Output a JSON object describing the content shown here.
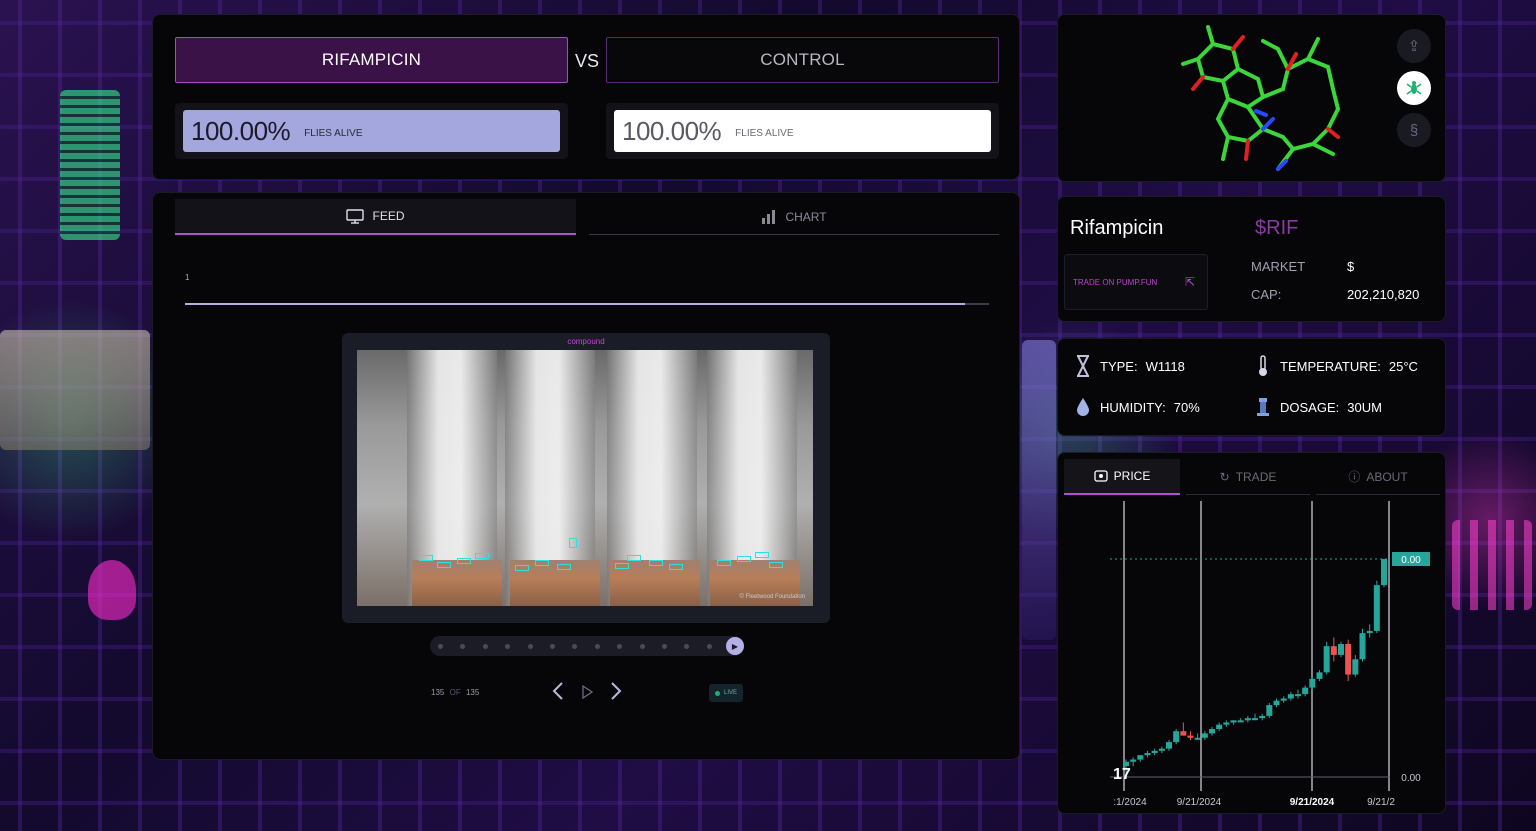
{
  "compare": {
    "left_compound": "RIFAMPICIN",
    "vs": "VS",
    "right_compound": "CONTROL",
    "left_alive": {
      "percent": "100.00%",
      "label": "FLIES ALIVE"
    },
    "right_alive": {
      "percent": "100.00%",
      "label": "FLIES ALIVE"
    }
  },
  "feed": {
    "tabs": [
      {
        "label": "FEED",
        "icon": "monitor-icon",
        "active": true
      },
      {
        "label": "CHART",
        "icon": "bar-chart-icon",
        "active": false
      }
    ],
    "progress_label": "1",
    "progress_fraction": 0.97,
    "video_caption": "compound",
    "video_watermark": "© Fleetwood Foundation",
    "frame_current": "135",
    "frame_of": "OF",
    "frame_total": "135",
    "live_label": "LIVE",
    "timeline_dots": 14
  },
  "molecule": {
    "buttons": [
      {
        "icon": "upload-icon"
      },
      {
        "icon": "fly-icon"
      },
      {
        "icon": "dna-icon"
      }
    ]
  },
  "token": {
    "name": "Rifampicin",
    "ticker": "$RIF",
    "trade_link": "TRADE ON PUMP.FUN",
    "market_cap_label_1": "MARKET",
    "market_cap_label_2": "CAP:",
    "market_cap_currency": "$",
    "market_cap_value": "202,210,820"
  },
  "specs": {
    "type_label": "TYPE:",
    "type_value": "W1118",
    "temperature_label": "TEMPERATURE:",
    "temperature_value": "25°C",
    "humidity_label": "HUMIDITY:",
    "humidity_value": "70%",
    "dosage_label": "DOSAGE:",
    "dosage_value": "30UM"
  },
  "price_panel": {
    "tabs": [
      {
        "label": "PRICE",
        "icon": "price-tag-icon",
        "active": true
      },
      {
        "label": "TRADE",
        "icon": "swap-icon",
        "active": false
      },
      {
        "label": "ABOUT",
        "icon": "info-icon",
        "active": false
      }
    ]
  },
  "chart_data": {
    "type": "candlestick",
    "x_tick_labels": [
      ":1/2024",
      "9/21/2024",
      "9/21/2024",
      "9/21/2"
    ],
    "x_tick_bold_index": 2,
    "y_labels": [
      "0.00"
    ],
    "last_price_label": "0.00",
    "up_color": "#26a69a",
    "down_color": "#ef5350",
    "candles": [
      {
        "o": 0.05,
        "h": 0.08,
        "l": 0.02,
        "c": 0.07
      },
      {
        "o": 0.07,
        "h": 0.09,
        "l": 0.05,
        "c": 0.08
      },
      {
        "o": 0.08,
        "h": 0.1,
        "l": 0.07,
        "c": 0.1
      },
      {
        "o": 0.1,
        "h": 0.12,
        "l": 0.09,
        "c": 0.11
      },
      {
        "o": 0.11,
        "h": 0.13,
        "l": 0.1,
        "c": 0.12
      },
      {
        "o": 0.12,
        "h": 0.14,
        "l": 0.11,
        "c": 0.13
      },
      {
        "o": 0.13,
        "h": 0.17,
        "l": 0.12,
        "c": 0.16
      },
      {
        "o": 0.16,
        "h": 0.22,
        "l": 0.15,
        "c": 0.21
      },
      {
        "o": 0.21,
        "h": 0.25,
        "l": 0.19,
        "c": 0.19
      },
      {
        "o": 0.19,
        "h": 0.21,
        "l": 0.17,
        "c": 0.18
      },
      {
        "o": 0.18,
        "h": 0.2,
        "l": 0.17,
        "c": 0.18
      },
      {
        "o": 0.18,
        "h": 0.21,
        "l": 0.17,
        "c": 0.2
      },
      {
        "o": 0.2,
        "h": 0.23,
        "l": 0.19,
        "c": 0.22
      },
      {
        "o": 0.22,
        "h": 0.25,
        "l": 0.21,
        "c": 0.24
      },
      {
        "o": 0.24,
        "h": 0.26,
        "l": 0.23,
        "c": 0.25
      },
      {
        "o": 0.25,
        "h": 0.26,
        "l": 0.24,
        "c": 0.26
      },
      {
        "o": 0.26,
        "h": 0.27,
        "l": 0.25,
        "c": 0.26
      },
      {
        "o": 0.26,
        "h": 0.28,
        "l": 0.25,
        "c": 0.27
      },
      {
        "o": 0.27,
        "h": 0.29,
        "l": 0.26,
        "c": 0.27
      },
      {
        "o": 0.27,
        "h": 0.29,
        "l": 0.26,
        "c": 0.28
      },
      {
        "o": 0.28,
        "h": 0.34,
        "l": 0.27,
        "c": 0.33
      },
      {
        "o": 0.33,
        "h": 0.36,
        "l": 0.32,
        "c": 0.35
      },
      {
        "o": 0.35,
        "h": 0.37,
        "l": 0.34,
        "c": 0.36
      },
      {
        "o": 0.36,
        "h": 0.39,
        "l": 0.35,
        "c": 0.38
      },
      {
        "o": 0.38,
        "h": 0.4,
        "l": 0.36,
        "c": 0.38
      },
      {
        "o": 0.38,
        "h": 0.42,
        "l": 0.37,
        "c": 0.41
      },
      {
        "o": 0.41,
        "h": 0.46,
        "l": 0.4,
        "c": 0.45
      },
      {
        "o": 0.45,
        "h": 0.49,
        "l": 0.44,
        "c": 0.48
      },
      {
        "o": 0.48,
        "h": 0.62,
        "l": 0.47,
        "c": 0.6
      },
      {
        "o": 0.6,
        "h": 0.64,
        "l": 0.53,
        "c": 0.56
      },
      {
        "o": 0.56,
        "h": 0.62,
        "l": 0.55,
        "c": 0.61
      },
      {
        "o": 0.61,
        "h": 0.63,
        "l": 0.44,
        "c": 0.47
      },
      {
        "o": 0.47,
        "h": 0.56,
        "l": 0.46,
        "c": 0.54
      },
      {
        "o": 0.54,
        "h": 0.68,
        "l": 0.53,
        "c": 0.66
      },
      {
        "o": 0.66,
        "h": 0.7,
        "l": 0.64,
        "c": 0.67
      },
      {
        "o": 0.67,
        "h": 0.9,
        "l": 0.66,
        "c": 0.88
      },
      {
        "o": 0.88,
        "h": 1.0,
        "l": 0.87,
        "c": 1.0
      }
    ]
  }
}
